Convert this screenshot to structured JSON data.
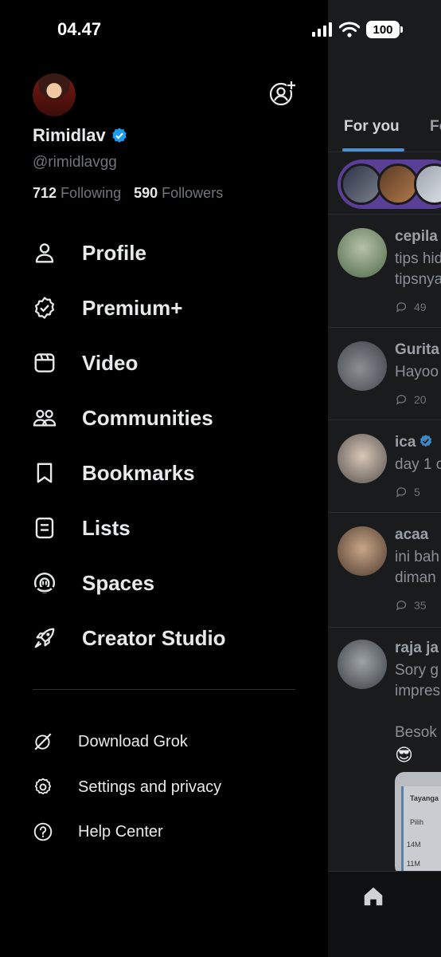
{
  "status_bar": {
    "time": "04.47",
    "battery": "100"
  },
  "profile": {
    "name": "Rimidlav",
    "handle": "@rimidlavgg",
    "following_count": "712",
    "following_label": "Following",
    "followers_count": "590",
    "followers_label": "Followers"
  },
  "menu": {
    "items": [
      {
        "label": "Profile",
        "icon": "person-icon"
      },
      {
        "label": "Premium+",
        "icon": "verified-badge-icon"
      },
      {
        "label": "Video",
        "icon": "video-icon"
      },
      {
        "label": "Communities",
        "icon": "people-icon"
      },
      {
        "label": "Bookmarks",
        "icon": "bookmark-icon"
      },
      {
        "label": "Lists",
        "icon": "list-icon"
      },
      {
        "label": "Spaces",
        "icon": "microphone-icon"
      },
      {
        "label": "Creator Studio",
        "icon": "rocket-icon"
      }
    ],
    "secondary": [
      {
        "label": "Download Grok",
        "icon": "grok-icon"
      },
      {
        "label": "Settings and privacy",
        "icon": "gear-icon"
      },
      {
        "label": "Help Center",
        "icon": "help-icon"
      }
    ]
  },
  "feed": {
    "tabs": [
      "For you",
      "Fo"
    ],
    "posts": [
      {
        "name": "cepila",
        "line1": "tips hid",
        "line2": "tipsnya",
        "replies": "49"
      },
      {
        "name": "Gurita",
        "line1": "Hayoo",
        "line2": "",
        "replies": "20"
      },
      {
        "name": "ica",
        "line1": "day 1 c",
        "line2": "",
        "replies": "5"
      },
      {
        "name": "acaa",
        "line1": "ini bah",
        "line2": "diman",
        "replies": "35"
      },
      {
        "name": "raja ja",
        "line1": "Sory g",
        "line2": "impres",
        "replies": ""
      }
    ],
    "teaser": "Besok",
    "teaser_emoji": "😎",
    "shot_texts": [
      "Tayanga",
      "Pilih",
      "14M",
      "11M"
    ]
  },
  "colors": {
    "accent": "#1d9bf0",
    "background": "#000000",
    "muted": "#71767b"
  }
}
